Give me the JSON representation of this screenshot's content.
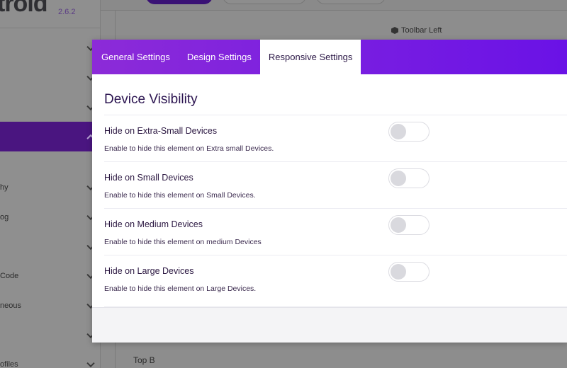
{
  "app": {
    "brand": "troid",
    "version": "2.6.2"
  },
  "sidebar": {
    "items": [
      {
        "label": ""
      },
      {
        "label": ""
      },
      {
        "label": ""
      },
      {
        "label": ""
      },
      {
        "label": "hy"
      },
      {
        "label": "og"
      },
      {
        "label": ""
      },
      {
        "label": "Code"
      },
      {
        "label": "neous"
      },
      {
        "label": ""
      },
      {
        "label": "ofiles"
      }
    ]
  },
  "background": {
    "toolbar_left": "Toolbar Left",
    "top_b": "Top B"
  },
  "modal": {
    "tabs": [
      {
        "label": "General Settings"
      },
      {
        "label": "Design Settings"
      },
      {
        "label": "Responsive Settings"
      }
    ],
    "active_tab": "Responsive Settings",
    "section_title": "Device Visibility",
    "settings": [
      {
        "label": "Hide on Extra-Small Devices",
        "description": "Enable to hide this element on Extra small Devices.",
        "enabled": false
      },
      {
        "label": "Hide on Small Devices",
        "description": "Enable to hide this element on Small Devices.",
        "enabled": false
      },
      {
        "label": "Hide on Medium Devices",
        "description": "Enable to hide this element on medium Devices",
        "enabled": false
      },
      {
        "label": "Hide on Large Devices",
        "description": "Enable to hide this element on Large Devices.",
        "enabled": false
      }
    ]
  },
  "colors": {
    "accent_start": "#8c2bd8",
    "accent_end": "#6a12e6",
    "title_text": "#2b1450"
  }
}
